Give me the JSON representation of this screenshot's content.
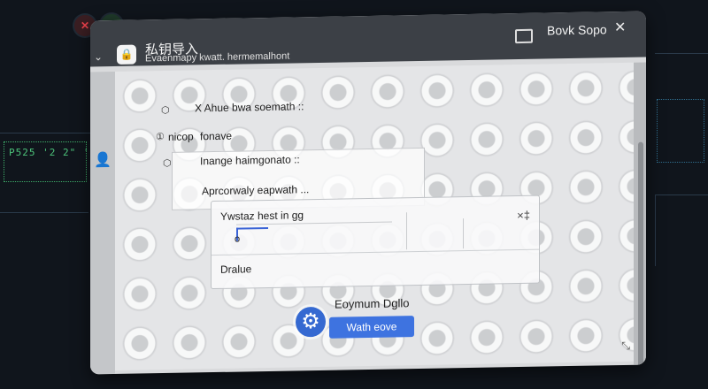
{
  "window": {
    "title": "私钥导入",
    "subtitle": "Evaenmapy kwatt. hermemalhont",
    "win_title": "Bovk Sopo",
    "close_glyph": "✕"
  },
  "background": {
    "code_text": "P525 '2 2\" '5"
  },
  "options": [
    {
      "icon": "⬡",
      "label": "X Ahue bwa soemath ::"
    },
    {
      "icon": "①",
      "label": "nicop",
      "value": "fonave"
    },
    {
      "icon": "⬡",
      "label": "Inange  haimgonato ::"
    }
  ],
  "section_label": "Aprcorwaly eapwath ...",
  "card": {
    "title": "Ywstaz hest in gg",
    "field_value": "o",
    "close_glyph": "×‡",
    "footer": "Dralue"
  },
  "action": {
    "label": "Eoymum Dgllo",
    "button": "Wath eove"
  },
  "icons": {
    "close": "close-icon",
    "up": "arrow-up-icon",
    "gear": "gear-icon",
    "user": "user-icon"
  },
  "colors": {
    "accent": "#3e73e0",
    "close_red": "#e8404b",
    "up_green": "#3ecf6a"
  }
}
